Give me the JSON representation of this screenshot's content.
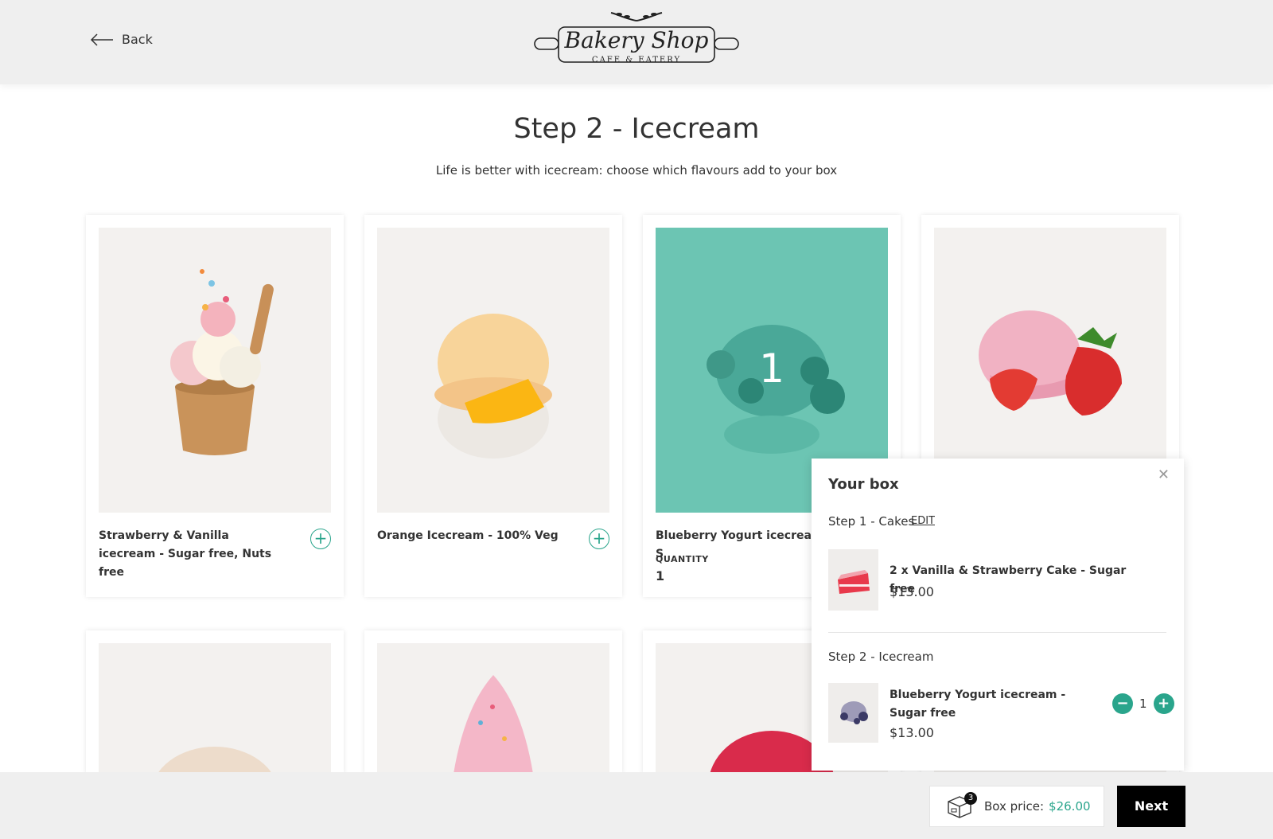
{
  "header": {
    "back_label": "Back",
    "logo_title": "Bakery Shop",
    "logo_subtitle": "CAFE & EATERY"
  },
  "page": {
    "title": "Step 2 - Icecream",
    "subtitle": "Life is better with icecream: choose which flavours add to your box"
  },
  "products": [
    {
      "name": "Strawberry & Vanilla icecream - Sugar free, Nuts free",
      "selected": false
    },
    {
      "name": "Orange Icecream - 100% Veg",
      "selected": false
    },
    {
      "name": "Blueberry Yogurt icecream - S",
      "selected": true,
      "quantity_label": "QUANTITY",
      "quantity": "1"
    },
    {
      "name": "",
      "selected": false
    }
  ],
  "box": {
    "title": "Your box",
    "close_icon": "close-icon",
    "step1_label": "Step 1 - Cakes",
    "edit_label": "EDIT",
    "step1_item_name": "2 x Vanilla & Strawberry Cake - Sugar free",
    "step1_item_price": "$13.00",
    "step2_label": "Step 2 - Icecream",
    "step2_item_name": "Blueberry Yogurt icecream - Sugar free",
    "step2_item_price": "$13.00",
    "step2_item_qty": "1"
  },
  "footer": {
    "box_count": "3",
    "price_label": "Box price:",
    "price_value": "$26.00",
    "next_label": "Next"
  },
  "colors": {
    "accent": "#2aa58c",
    "selected_overlay": "#6cc5b3"
  }
}
